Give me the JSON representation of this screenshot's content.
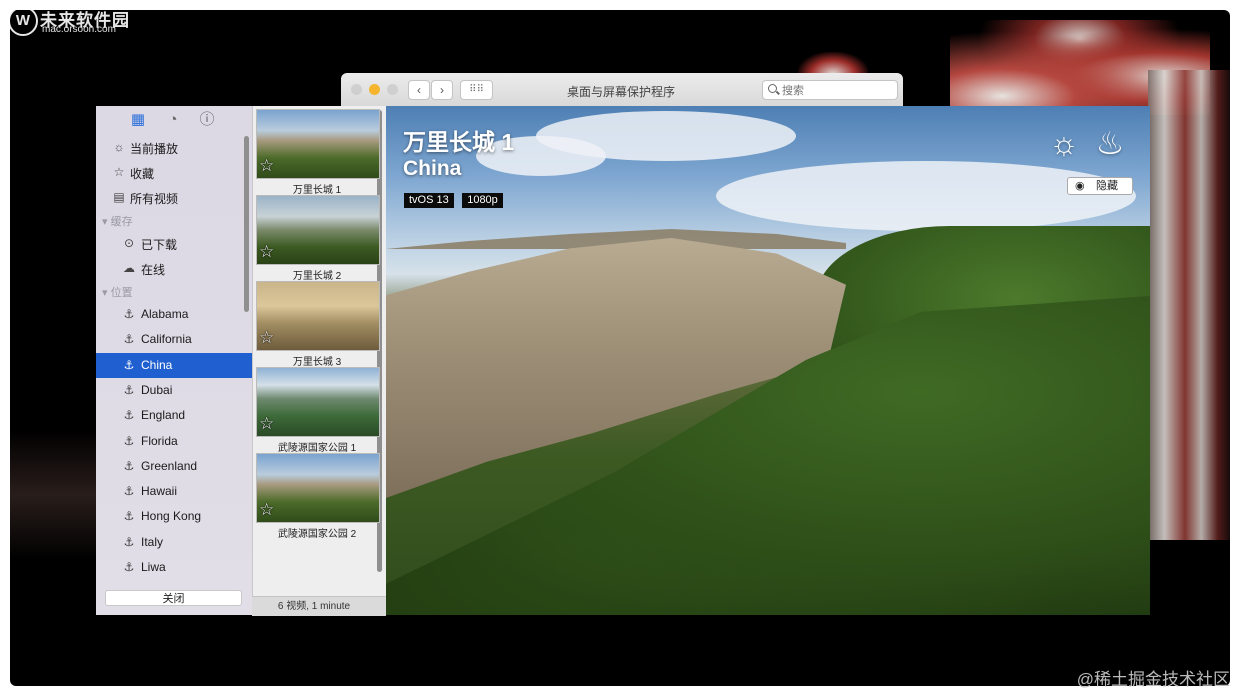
{
  "watermark": {
    "logo": "W",
    "title": "未来软件园",
    "subtitle": "mac.orsoon.com"
  },
  "credit": "@稀土掘金技术社区",
  "prefs_window": {
    "title": "桌面与屏幕保护程序",
    "search_placeholder": "搜索",
    "back": "‹",
    "forward": "›",
    "grid": "⠿⠿"
  },
  "sidebar": {
    "items": [
      {
        "label": "当前播放",
        "icon": "sun-icon",
        "glyph": "☼"
      },
      {
        "label": "收藏",
        "icon": "star-icon",
        "glyph": "☆"
      },
      {
        "label": "所有视频",
        "icon": "film-icon",
        "glyph": "▤"
      }
    ],
    "group_cache": "缓存",
    "cache_items": [
      {
        "label": "已下载",
        "icon": "download-icon",
        "glyph": "⊙"
      },
      {
        "label": "在线",
        "icon": "cloud-icon",
        "glyph": "☁"
      }
    ],
    "group_location": "位置",
    "locations": [
      "Alabama",
      "California",
      "China",
      "Dubai",
      "England",
      "Florida",
      "Greenland",
      "Hawaii",
      "Hong Kong",
      "Italy",
      "Liwa"
    ],
    "selected": "China",
    "close_label": "关闭"
  },
  "thumbnails": {
    "items": [
      {
        "caption": "万里长城 1"
      },
      {
        "caption": "万里长城 2"
      },
      {
        "caption": "万里长城 3"
      },
      {
        "caption": "武陵源国家公园 1"
      },
      {
        "caption": "武陵源国家公园 2"
      }
    ],
    "status": "6 视频, 1 minute"
  },
  "preview": {
    "title": "万里长城 1",
    "location": "China",
    "badges": [
      "tvOS 13",
      "1080p"
    ],
    "hide_label": "隐藏"
  }
}
